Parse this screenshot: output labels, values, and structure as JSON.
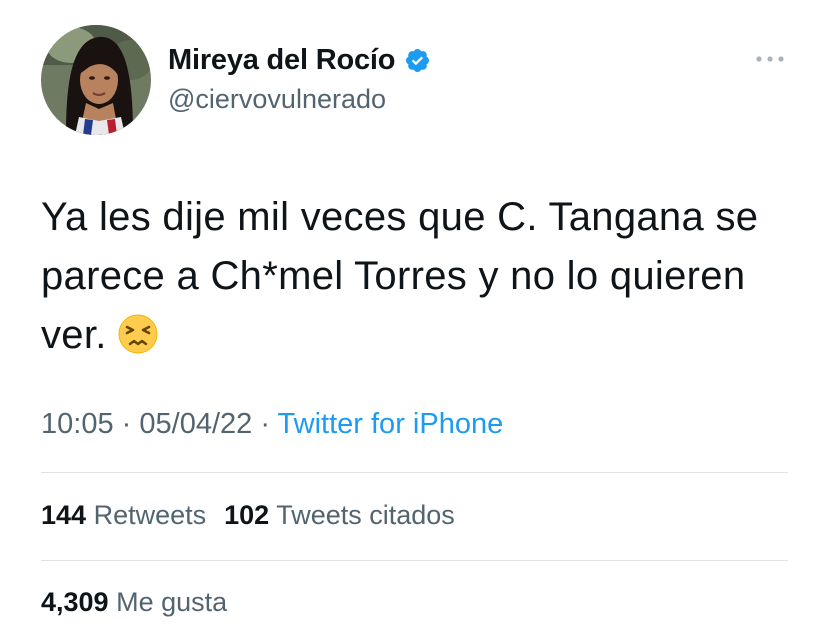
{
  "user": {
    "display_name": "Mireya del Rocío",
    "handle": "@ciervovulnerado",
    "verified": true,
    "avatar_icon": "profile-photo",
    "verified_icon": "verified-badge-icon"
  },
  "tweet": {
    "text": "Ya les dije mil veces que C. Tangana se parece a Ch*mel Torres y no lo quieren ver.",
    "emoji": "persevering-face-emoji"
  },
  "meta": {
    "time": "10:05",
    "separator": "·",
    "date": "05/04/22",
    "source": "Twitter for iPhone"
  },
  "stats": {
    "retweets_count": "144",
    "retweets_label": "Retweets",
    "quotes_count": "102",
    "quotes_label": "Tweets citados",
    "likes_count": "4,309",
    "likes_label": "Me gusta"
  },
  "colors": {
    "text_primary": "#0f1419",
    "text_secondary": "#536471",
    "accent": "#1d9bf0",
    "divider": "#dfe3e6"
  }
}
